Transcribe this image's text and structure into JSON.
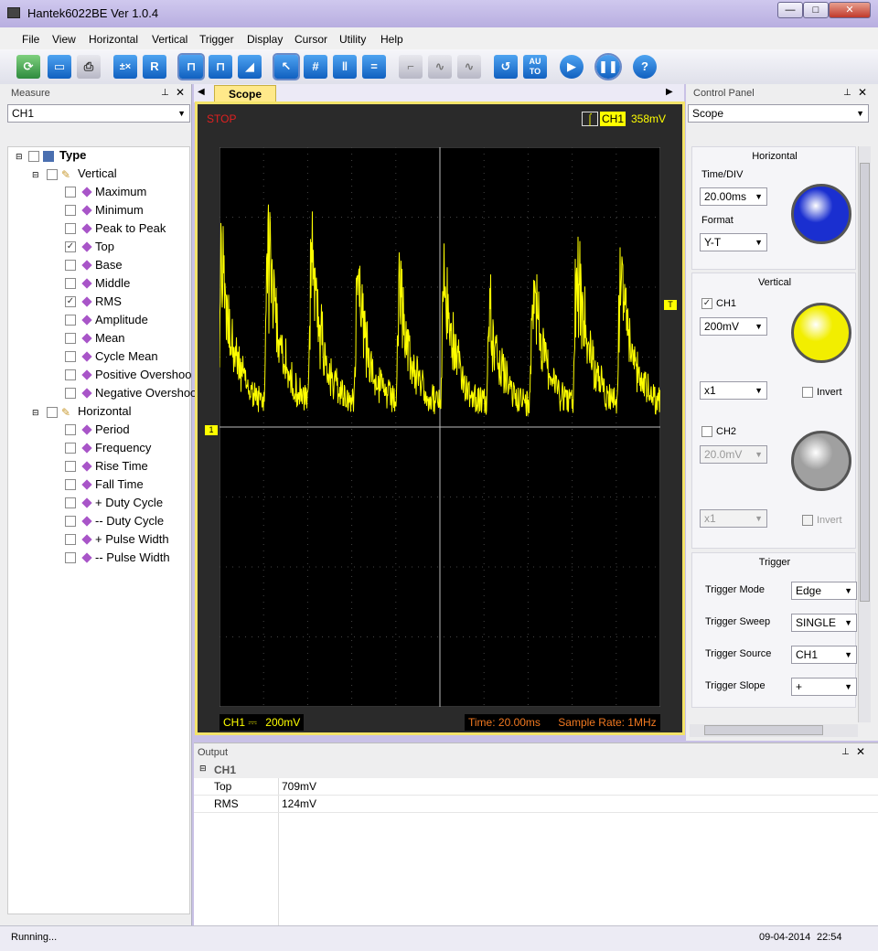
{
  "window": {
    "title": "Hantek6022BE Ver 1.0.4",
    "min": "—",
    "max": "□",
    "close": "✕"
  },
  "menu": [
    "File",
    "View",
    "Horizontal",
    "Vertical",
    "Trigger",
    "Display",
    "Cursor",
    "Utility",
    "Help"
  ],
  "toolbar": {
    "icons": [
      "open-icon",
      "save-icon",
      "print-icon",
      "math-icon",
      "ref-icon",
      "pulse-icon",
      "pulse2-icon",
      "ramp-icon",
      "cursor-icon",
      "grid-icon",
      "vbar-icon",
      "hbar-icon",
      "step-icon",
      "wave-icon",
      "sine-icon",
      "rotate-icon",
      "auto-icon",
      "play-icon",
      "pause-icon",
      "help-icon"
    ],
    "auto_label": "AU TO",
    "ref_label": "R",
    "help_label": "?"
  },
  "measure": {
    "title": "Measure",
    "pin": "ᵖ",
    "close": "✕",
    "channel": "CH1",
    "tree": {
      "root": "Type",
      "vertical": "Vertical",
      "horizontal": "Horizontal",
      "vertical_items": [
        {
          "label": "Maximum",
          "checked": false
        },
        {
          "label": "Minimum",
          "checked": false
        },
        {
          "label": "Peak to Peak",
          "checked": false
        },
        {
          "label": "Top",
          "checked": true
        },
        {
          "label": "Base",
          "checked": false
        },
        {
          "label": "Middle",
          "checked": false
        },
        {
          "label": "RMS",
          "checked": true
        },
        {
          "label": "Amplitude",
          "checked": false
        },
        {
          "label": "Mean",
          "checked": false
        },
        {
          "label": "Cycle Mean",
          "checked": false
        },
        {
          "label": "Positive Overshoo",
          "checked": false
        },
        {
          "label": "Negative Overshoo",
          "checked": false
        }
      ],
      "horizontal_items": [
        {
          "label": "Period",
          "checked": false
        },
        {
          "label": "Frequency",
          "checked": false
        },
        {
          "label": "Rise Time",
          "checked": false
        },
        {
          "label": "Fall Time",
          "checked": false
        },
        {
          "label": "+ Duty Cycle",
          "checked": false
        },
        {
          "label": "-- Duty Cycle",
          "checked": false
        },
        {
          "label": "+ Pulse Width",
          "checked": false
        },
        {
          "label": "-- Pulse Width",
          "checked": false
        }
      ]
    }
  },
  "scope": {
    "tab": "Scope",
    "status": "STOP",
    "trig_channel": "CH1",
    "trig_level": "358mV",
    "ch_marker": "1",
    "trig_marker": "T",
    "bottom_ch": "CH1",
    "bottom_coupling": "⎓",
    "bottom_volts": "200mV",
    "time": "Time: 20.00ms",
    "sample_rate": "Sample Rate: 1MHz"
  },
  "control": {
    "title": "Control Panel",
    "pin": "ᵖ",
    "close": "✕",
    "mode": "Scope",
    "horizontal": {
      "heading": "Horizontal",
      "timediv_label": "Time/DIV",
      "timediv": "20.00ms",
      "format_label": "Format",
      "format": "Y-T"
    },
    "vertical": {
      "heading": "Vertical",
      "ch1": "CH1",
      "ch1_volts": "200mV",
      "ch1_probe": "x1",
      "invert": "Invert",
      "ch2": "CH2",
      "ch2_volts": "20.0mV",
      "ch2_probe": "x1",
      "invert2": "Invert"
    },
    "trigger": {
      "heading": "Trigger",
      "mode_label": "Trigger Mode",
      "mode": "Edge",
      "sweep_label": "Trigger Sweep",
      "sweep": "SINGLE",
      "source_label": "Trigger Source",
      "source": "CH1",
      "slope_label": "Trigger Slope",
      "slope": "+"
    },
    "colors": {
      "ch1_knob": "#f2ee00",
      "time_knob": "#1a2fd0",
      "ch2_knob": "#a0a0a0"
    }
  },
  "output": {
    "title": "Output",
    "pin": "ᵖ",
    "close": "✕",
    "group": "CH1",
    "rows": [
      {
        "name": "Top",
        "value": "709mV"
      },
      {
        "name": "RMS",
        "value": "124mV"
      }
    ]
  },
  "statusbar": {
    "left": "Running...",
    "date": "09-04-2014",
    "time": "22:54"
  },
  "trace_color": "#ffff00"
}
